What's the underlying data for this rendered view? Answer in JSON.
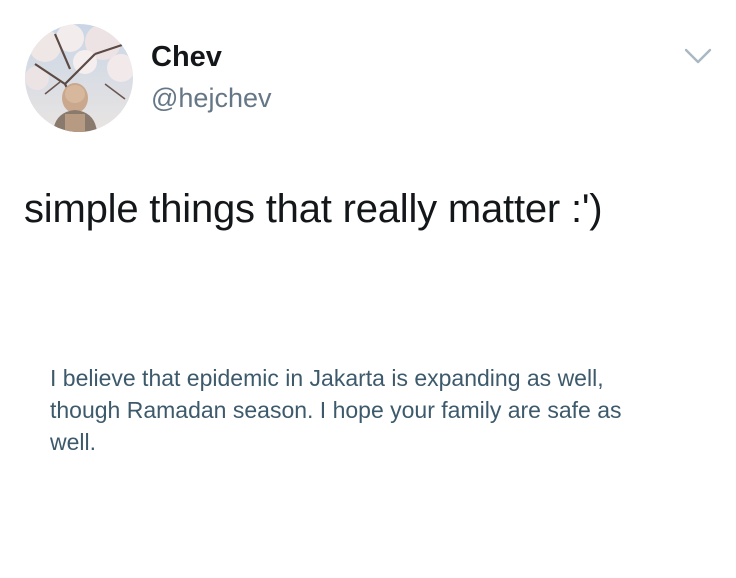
{
  "tweet": {
    "author": {
      "display_name": "Chev",
      "handle": "@hejchev",
      "avatar_icon": "avatar-photo"
    },
    "menu_icon": "chevron-down-icon",
    "text": "simple things that really matter :')",
    "attached_image": {
      "text": "I believe that epidemic in Jakarta is expanding as well, though Ramadan season. I hope your family are safe as well."
    }
  },
  "colors": {
    "primary_text": "#14171a",
    "secondary_text": "#657786",
    "image_text": "#3d5a6c",
    "chevron": "#aab8c2"
  }
}
